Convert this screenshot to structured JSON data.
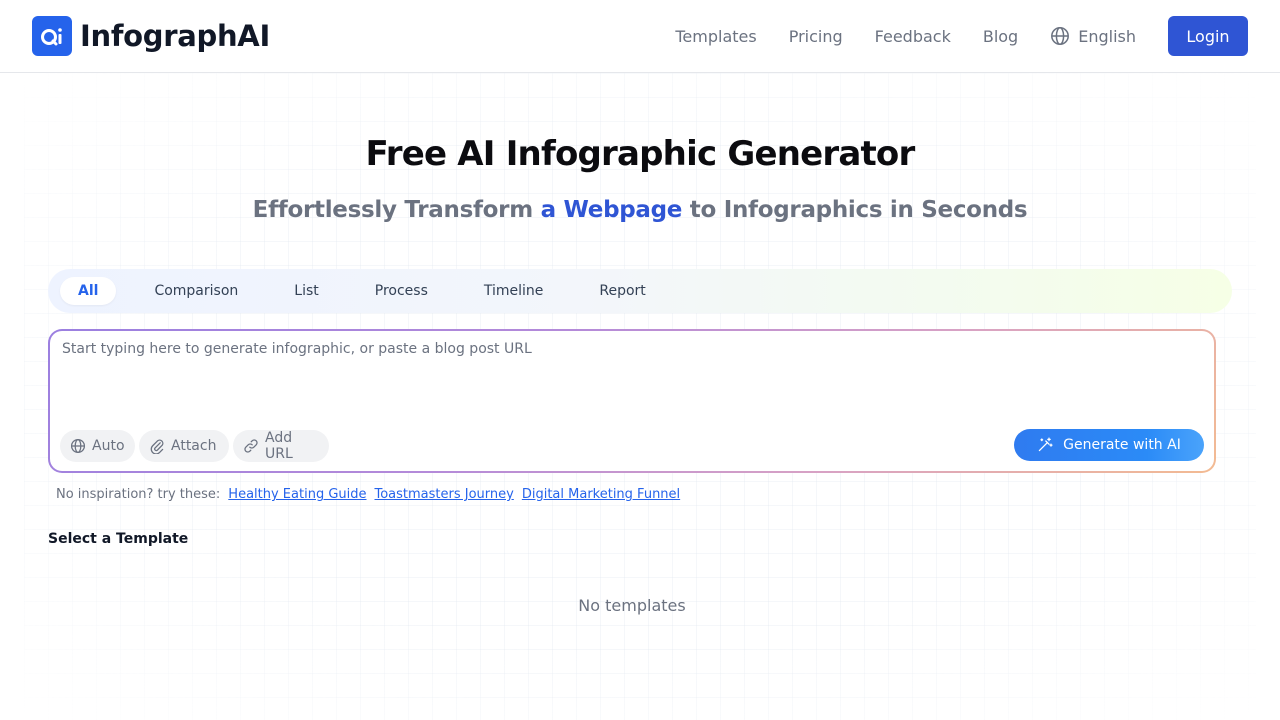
{
  "header": {
    "brand_name": "InfographAI",
    "logo_text": "Qi",
    "nav": [
      {
        "label": "Templates"
      },
      {
        "label": "Pricing"
      },
      {
        "label": "Feedback"
      },
      {
        "label": "Blog"
      }
    ],
    "language": "English",
    "login_label": "Login"
  },
  "hero": {
    "title": "Free AI Infographic Generator",
    "subtitle_pre": "Effortlessly Transform ",
    "subtitle_accent": "a Webpage",
    "subtitle_post": " to Infographics in Seconds"
  },
  "tabs": [
    {
      "label": "All",
      "active": true
    },
    {
      "label": "Comparison",
      "active": false
    },
    {
      "label": "List",
      "active": false
    },
    {
      "label": "Process",
      "active": false
    },
    {
      "label": "Timeline",
      "active": false
    },
    {
      "label": "Report",
      "active": false
    }
  ],
  "prompt": {
    "placeholder": "Start typing here to generate infographic, or paste a blog post URL",
    "value": "",
    "chips": {
      "auto": "Auto",
      "attach": "Attach",
      "add_url": "Add URL"
    },
    "generate_label": "Generate with AI"
  },
  "inspiration": {
    "label": "No inspiration? try these:",
    "links": [
      "Healthy Eating Guide",
      "Toastmasters Journey",
      "Digital Marketing Funnel"
    ]
  },
  "templates": {
    "section_title": "Select a Template",
    "empty_text": "No templates"
  },
  "colors": {
    "brand": "#2f55d4",
    "accent_blue": "#2563eb",
    "muted_text": "#6b7280"
  }
}
